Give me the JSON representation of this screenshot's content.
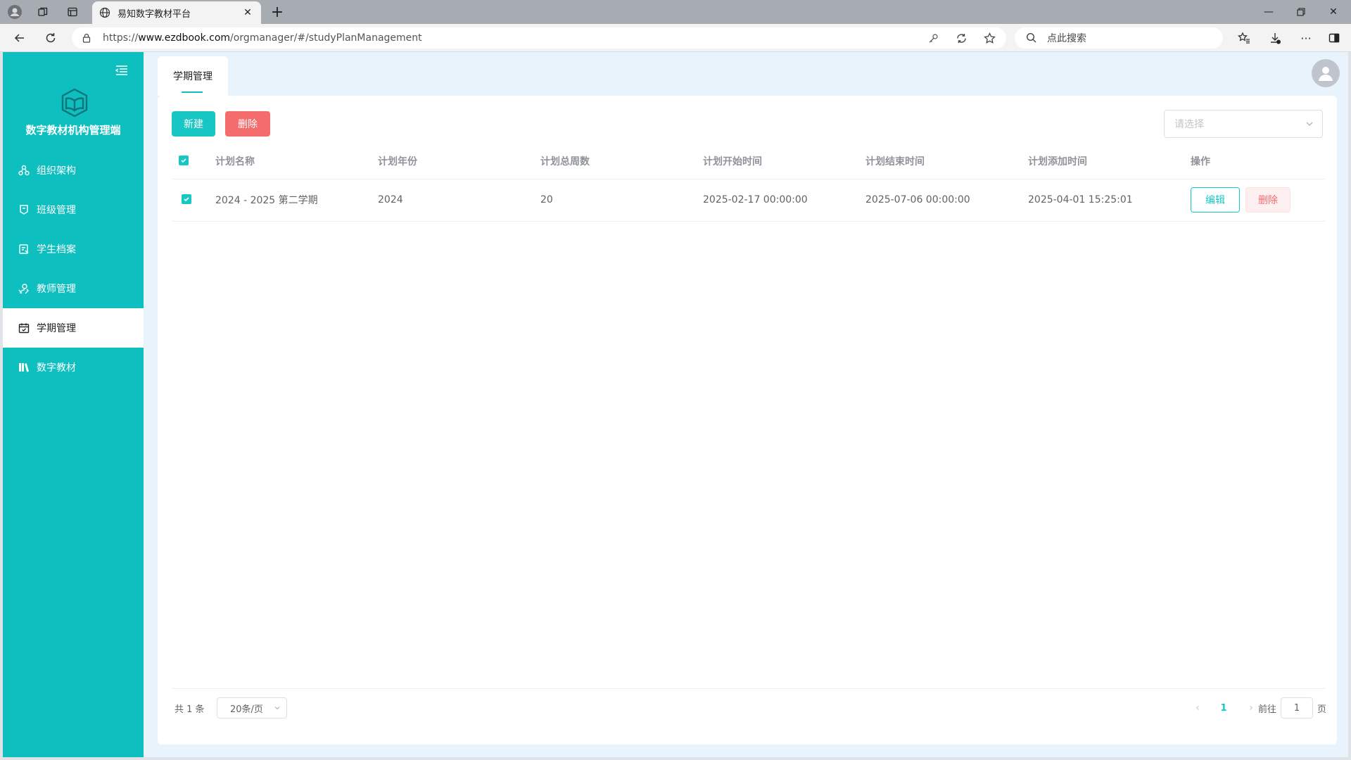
{
  "browser": {
    "tab_title": "易知数字教材平台",
    "url_scheme": "https://",
    "url_host": "www.ezdbook.com",
    "url_path": "/orgmanager/#/studyPlanManagement",
    "search_placeholder": "点此搜索"
  },
  "sidebar": {
    "brand": "数字教材机构管理端",
    "items": [
      {
        "label": "组织架构",
        "icon": "org-structure-icon"
      },
      {
        "label": "班级管理",
        "icon": "class-icon"
      },
      {
        "label": "学生档案",
        "icon": "student-file-icon"
      },
      {
        "label": "教师管理",
        "icon": "teacher-icon"
      },
      {
        "label": "学期管理",
        "icon": "calendar-icon",
        "active": true
      },
      {
        "label": "数字教材",
        "icon": "books-icon"
      }
    ]
  },
  "header": {
    "page_tab": "学期管理"
  },
  "toolbar": {
    "new_label": "新建",
    "delete_label": "删除",
    "select_placeholder": "请选择"
  },
  "table": {
    "columns": [
      "计划名称",
      "计划年份",
      "计划总周数",
      "计划开始时间",
      "计划结束时间",
      "计划添加时间",
      "操作"
    ],
    "rows": [
      {
        "checked": true,
        "name": "2024 - 2025 第二学期",
        "year": "2024",
        "weeks": "20",
        "start": "2025-02-17 00:00:00",
        "end": "2025-07-06 00:00:00",
        "added": "2025-04-01 15:25:01",
        "edit_label": "编辑",
        "delete_label": "删除"
      }
    ]
  },
  "pagination": {
    "total": "共 1 条",
    "page_size": "20条/页",
    "current_page": "1",
    "goto_label": "前往",
    "goto_value": "1",
    "goto_suffix": "页"
  },
  "colors": {
    "accent": "#0ebfbf",
    "danger": "#f56c6c"
  }
}
